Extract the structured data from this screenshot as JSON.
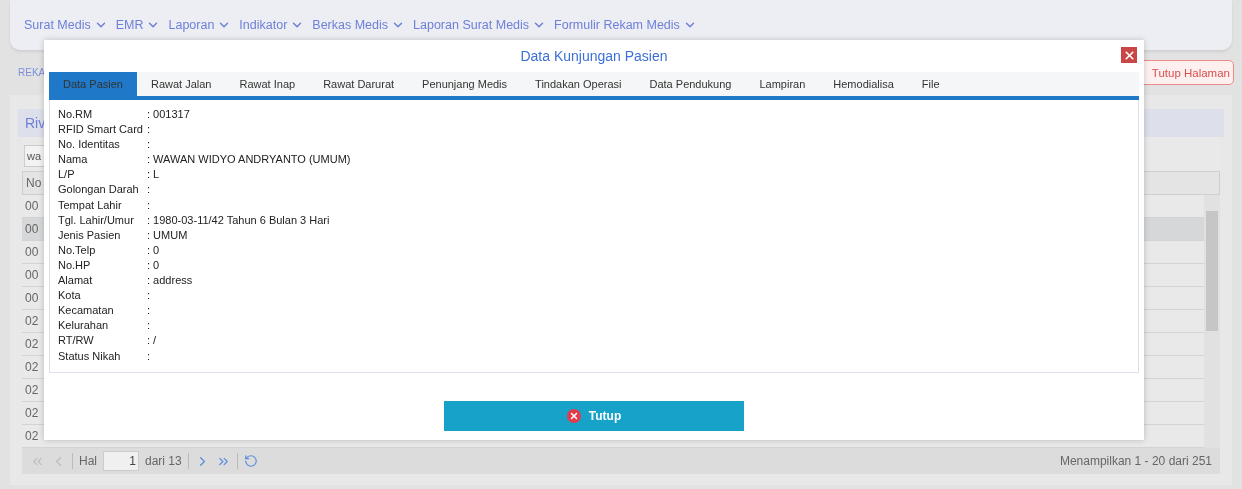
{
  "menu": [
    {
      "label": "Surat Medis"
    },
    {
      "label": "EMR"
    },
    {
      "label": "Laporan"
    },
    {
      "label": "Indikator"
    },
    {
      "label": "Berkas Medis"
    },
    {
      "label": "Laporan Surat Medis"
    },
    {
      "label": "Formulir Rekam Medis"
    }
  ],
  "breadcrumb": "REKA",
  "close_page_button": "Tutup Halaman",
  "panel": {
    "title": "Riv",
    "search": {
      "value": "wa"
    },
    "table": {
      "header": "No",
      "rows": [
        {
          "cell": "00",
          "selected": false
        },
        {
          "cell": "00",
          "selected": true
        },
        {
          "cell": "00",
          "selected": false
        },
        {
          "cell": "00",
          "selected": false
        },
        {
          "cell": "00",
          "selected": false
        },
        {
          "cell": "02",
          "selected": false
        },
        {
          "cell": "02",
          "selected": false
        },
        {
          "cell": "02",
          "selected": false
        },
        {
          "cell": "02",
          "selected": false
        },
        {
          "cell": "02",
          "selected": false
        },
        {
          "cell": "02",
          "selected": false
        }
      ]
    },
    "pagination": {
      "page_label": "Hal",
      "page": "1",
      "of": "dari 13",
      "summary": "Menampilkan 1 - 20 dari 251"
    }
  },
  "modal": {
    "title": "Data Kunjungan Pasien",
    "tabs": [
      {
        "label": "Data Pasien",
        "selected": true
      },
      {
        "label": "Rawat Jalan",
        "selected": false
      },
      {
        "label": "Rawat Inap",
        "selected": false
      },
      {
        "label": "Rawat Darurat",
        "selected": false
      },
      {
        "label": "Penunjang Medis",
        "selected": false
      },
      {
        "label": "Tindakan Operasi",
        "selected": false
      },
      {
        "label": "Data Pendukung",
        "selected": false
      },
      {
        "label": "Lampiran",
        "selected": false
      },
      {
        "label": "Hemodialisa",
        "selected": false
      },
      {
        "label": "File",
        "selected": false
      }
    ],
    "fields": [
      {
        "label": "No.RM",
        "value": ": 001317"
      },
      {
        "label": "RFID Smart Card",
        "value": ":"
      },
      {
        "label": "No. Identitas",
        "value": ":"
      },
      {
        "label": "Nama",
        "value": ": WAWAN WIDYO ANDRYANTO (UMUM)"
      },
      {
        "label": "L/P",
        "value": ": L"
      },
      {
        "label": "Golongan Darah",
        "value": ":"
      },
      {
        "label": "Tempat Lahir",
        "value": ":"
      },
      {
        "label": "Tgl. Lahir/Umur",
        "value": ": 1980-03-11/42 Tahun 6 Bulan 3 Hari"
      },
      {
        "label": "Jenis Pasien",
        "value": ": UMUM"
      },
      {
        "label": "No.Telp",
        "value": ": 0"
      },
      {
        "label": "No.HP",
        "value": ": 0"
      },
      {
        "label": "Alamat",
        "value": ": address"
      },
      {
        "label": "Kota",
        "value": ":"
      },
      {
        "label": "Kecamatan",
        "value": ":"
      },
      {
        "label": "Kelurahan",
        "value": ":"
      },
      {
        "label": "RT/RW",
        "value": ": /"
      },
      {
        "label": "Status Nikah",
        "value": ":"
      }
    ],
    "button": "Tutup"
  }
}
